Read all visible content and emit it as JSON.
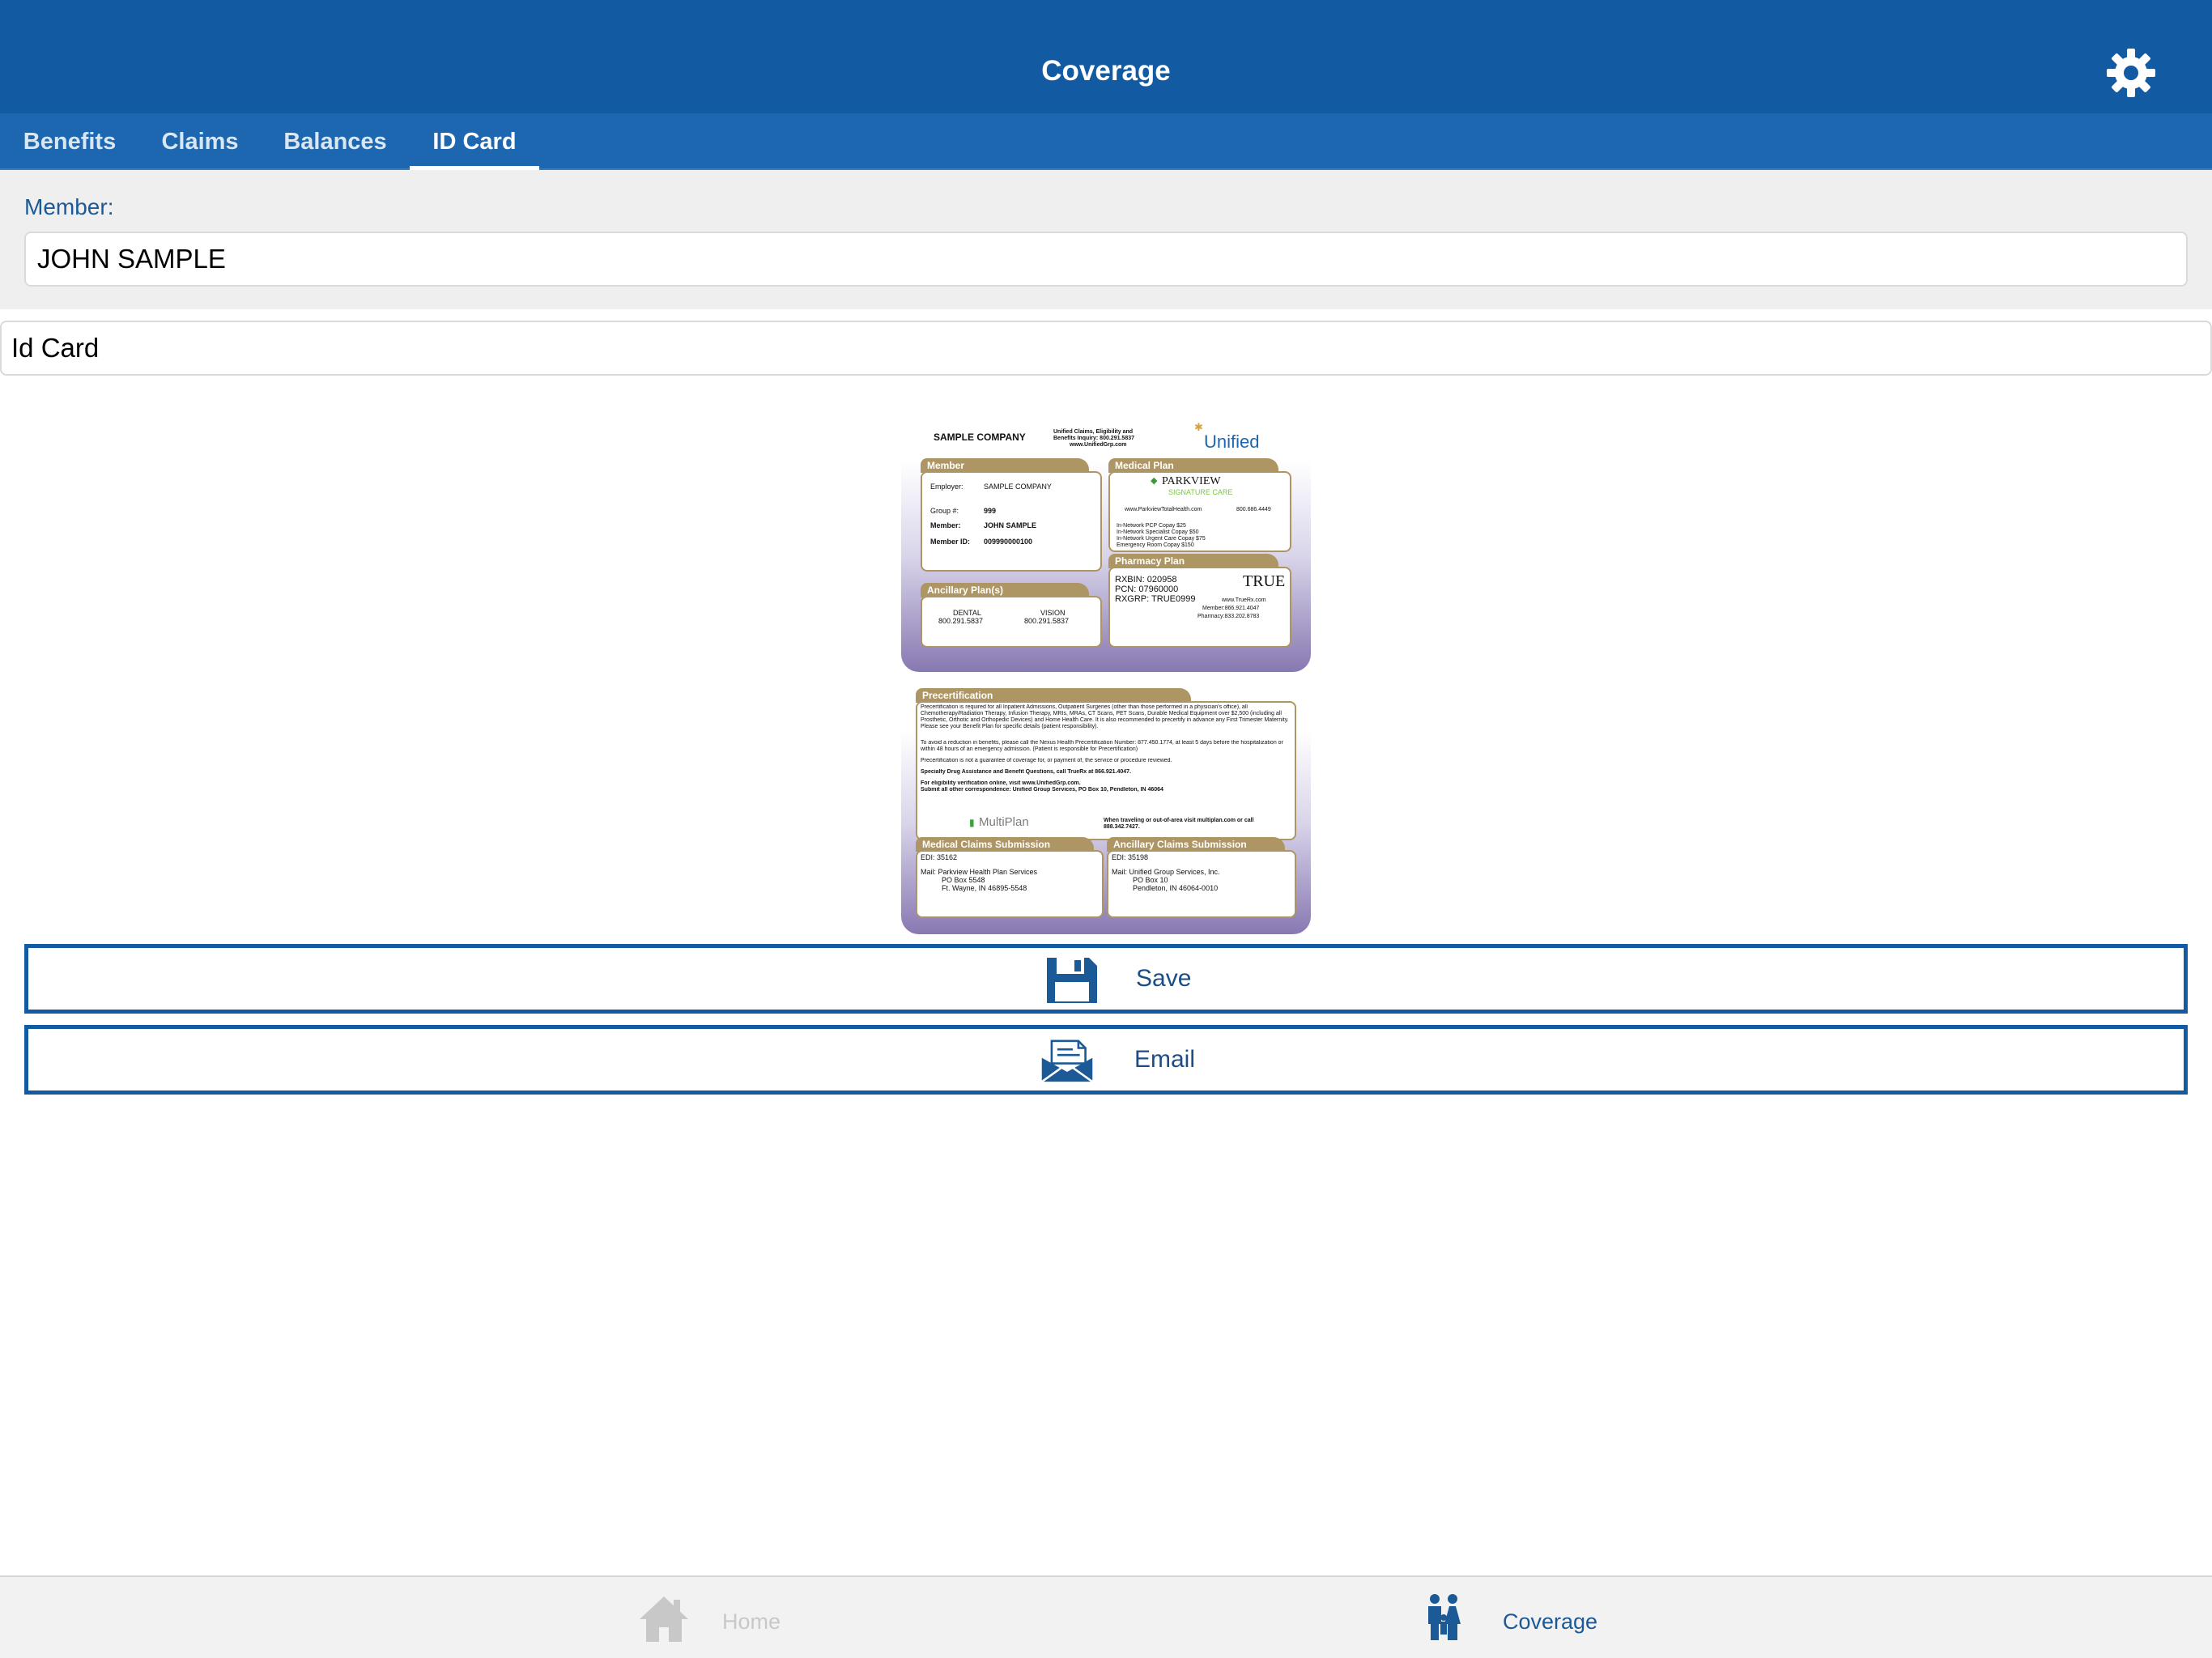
{
  "header": {
    "title": "Coverage",
    "settings_icon": "gear-icon"
  },
  "tabs": [
    {
      "label": "Benefits",
      "active": false
    },
    {
      "label": "Claims",
      "active": false
    },
    {
      "label": "Balances",
      "active": false
    },
    {
      "label": "ID Card",
      "active": true
    }
  ],
  "member": {
    "label": "Member:",
    "value": "JOHN SAMPLE"
  },
  "id_card_select": {
    "value": "Id Card"
  },
  "card_front": {
    "company": "SAMPLE COMPANY",
    "inquiry": [
      "Unified Claims, Eligibility and",
      "Benefits Inquiry: 800.291.5837",
      "www.UnifiedGrp.com"
    ],
    "logo": "Unified",
    "member_section": {
      "header": "Member",
      "employer_label": "Employer:",
      "employer": "SAMPLE COMPANY",
      "group_label": "Group #:",
      "group": "999",
      "member_label": "Member:",
      "member": "JOHN SAMPLE",
      "member_id_label": "Member ID:",
      "member_id": "009990000100"
    },
    "medical_section": {
      "header": "Medical Plan",
      "brand": "PARKVIEW",
      "brand_sub": "SIGNATURE CARE",
      "site": "www.ParkviewTotalHealth.com",
      "phone": "800.686.4449",
      "copays": [
        "In-Network PCP Copay $25",
        "In-Network Specialist Copay $50",
        "In-Network Urgent Care Copay $75",
        "Emergency Room Copay $150"
      ]
    },
    "ancillary_section": {
      "header": "Ancillary Plan(s)",
      "dental_label": "DENTAL",
      "dental_phone": "800.291.5837",
      "vision_label": "VISION",
      "vision_phone": "800.291.5837"
    },
    "pharmacy_section": {
      "header": "Pharmacy Plan",
      "lines": [
        "RXBIN:  020958",
        "PCN:  07960000",
        "RXGRP:  TRUE0999"
      ],
      "logo": "TRUE",
      "site": "www.TrueRx.com",
      "member_phone": "Member:866.921.4047",
      "pharmacy_phone": "Pharmacy:833.202.8783"
    }
  },
  "card_back": {
    "precert": {
      "header": "Precertification",
      "p1": "Precertification is required for all Inpatient Admissions, Outpatient Surgeries (other than those performed in a physician's office), all Chemotherapy/Radiation Therapy, Infusion Therapy, MRIs, MRAs, CT Scans, PET Scans, Durable Medical Equipment over $2,500 (including all Prosthetic, Orthotic and Orthopedic Devices) and Home Health Care. It is also recommended to precertify in advance any First Trimester Maternity. Please see your Benefit Plan for specific details (patient responsibility).",
      "p2": "To avoid a reduction in benefits, please call the Nexus Health Precertification Number: 877.450.1774, at least 5 days before the hospitalization or within 48 hours of an emergency admission. (Patient is responsible for Precertification)",
      "p3": "Precertification is not a guarantee of coverage for, or payment of, the service or procedure reviewed.",
      "p4": "Specialty Drug Assistance and Benefit Questions, call TrueRx at 866.921.4047.",
      "p5": "For eligibility verification online, visit www.UnifiedGrp.com.",
      "p6": "Submit all other correspondence: Unified Group Services, PO Box 10, Pendleton, IN 46064",
      "multiplan": "MultiPlan",
      "multiplan_note": "When traveling or out-of-area visit multiplan.com or call 888.342.7427."
    },
    "medical_claims": {
      "header": "Medical Claims Submission",
      "edi": "EDI:  35162",
      "mail": [
        "Mail: Parkview Health Plan Services",
        "PO Box 5548",
        "Ft. Wayne, IN 46895-5548"
      ]
    },
    "ancillary_claims": {
      "header": "Ancillary Claims Submission",
      "edi": "EDI:  35198",
      "mail": [
        "Mail: Unified Group Services, Inc.",
        "PO Box 10",
        "Pendleton, IN 46064-0010"
      ]
    }
  },
  "actions": {
    "save": {
      "label": "Save",
      "icon": "floppy-disk-icon"
    },
    "email": {
      "label": "Email",
      "icon": "envelope-icon"
    }
  },
  "bottom_tabs": [
    {
      "label": "Home",
      "icon": "home-icon",
      "active": false
    },
    {
      "label": "Coverage",
      "icon": "family-icon",
      "active": true
    }
  ],
  "colors": {
    "primary": "#125ba3",
    "tabbar": "#1c67b0",
    "card_gold": "#ad9663",
    "card_purple": "#8878b1",
    "inactive": "#c8c8c8"
  }
}
